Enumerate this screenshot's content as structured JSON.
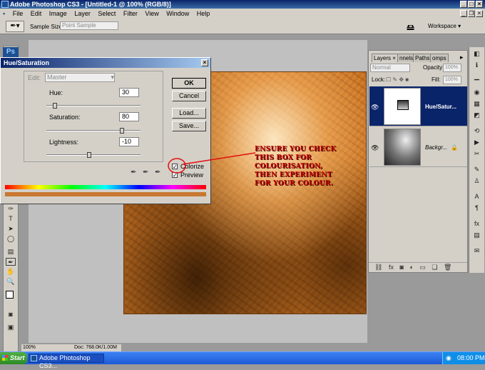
{
  "app": {
    "title": "Adobe Photoshop CS3 - [Untitled-1 @ 100% (RGB/8)]",
    "logo": "Ps"
  },
  "menu": [
    "File",
    "Edit",
    "Image",
    "Layer",
    "Select",
    "Filter",
    "View",
    "Window",
    "Help"
  ],
  "options": {
    "sample_label": "Sample Size:",
    "sample_value": "Point Sample",
    "workspace_label": "Workspace ▾"
  },
  "dialog": {
    "title": "Hue/Saturation",
    "edit_label": "Edit:",
    "edit_value": "Master",
    "hue_label": "Hue:",
    "hue_value": "30",
    "saturation_label": "Saturation:",
    "saturation_value": "80",
    "lightness_label": "Lightness:",
    "lightness_value": "-10",
    "ok": "OK",
    "cancel": "Cancel",
    "load": "Load...",
    "save": "Save...",
    "colorize": "Colorize",
    "preview": "Preview",
    "colorize_checked": true,
    "preview_checked": true
  },
  "annotation": {
    "lines": [
      "ENSURE YOU CHECK",
      "THIS BOX FOR",
      "COLOURISATION,",
      "THEN EXPERIMENT",
      "FOR YOUR COLOUR."
    ],
    "color": "#c00000"
  },
  "layers_panel": {
    "tabs": [
      "Layers ×",
      "nnels",
      "Paths",
      "omps"
    ],
    "blend_mode": "Normal",
    "opacity_label": "Opacity:",
    "opacity_value": "100%",
    "lock_label": "Lock:",
    "fill_label": "Fill:",
    "fill_value": "100%",
    "layers": [
      {
        "name": "Hue/Satur...",
        "selected": true
      },
      {
        "name": "Backgr...",
        "selected": false
      }
    ]
  },
  "statusbar": {
    "zoom": "100%",
    "doc": "Doc: 768.0K/1.00M"
  },
  "taskbar": {
    "start": "Start",
    "task": "Adobe Photoshop CS3...",
    "time": "08:00 PM"
  }
}
